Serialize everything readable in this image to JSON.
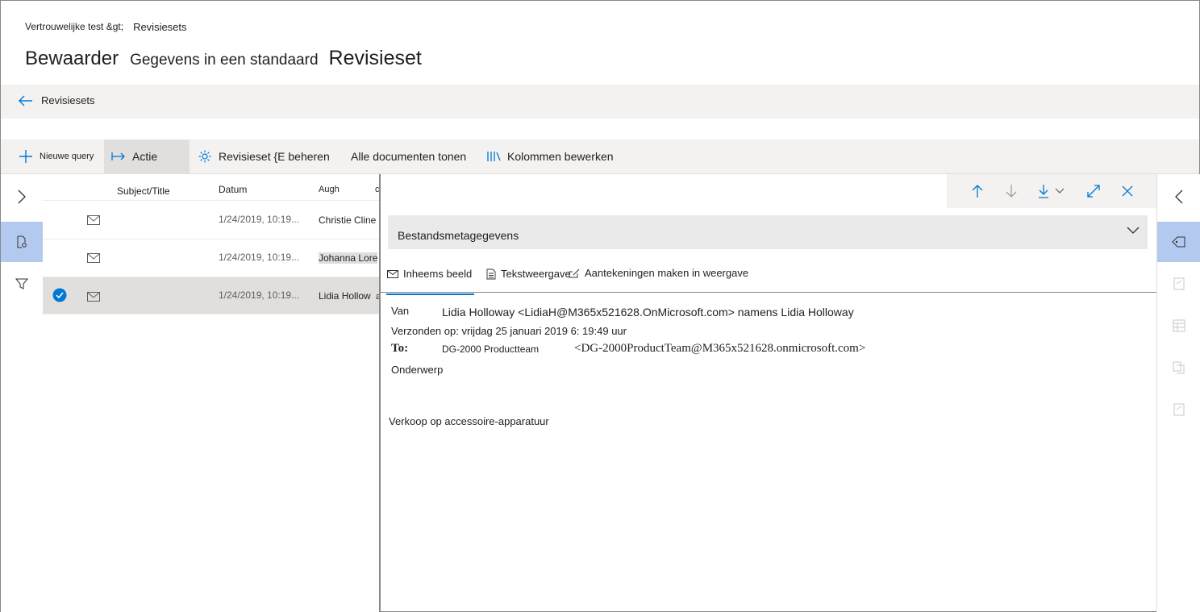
{
  "breadcrumb": {
    "parent": "Vertrouwelijke test &gt;",
    "current": "Revisiesets"
  },
  "title": {
    "part1": "Bewaarder",
    "part2": "Gegevens in een standaard",
    "part3": "Revisieset"
  },
  "back_label": "Revisiesets",
  "toolbar": {
    "new_query": "Nieuwe query",
    "action": "Actie",
    "manage": "Revisieset {E beheren",
    "show_all": "Alle documenten tonen",
    "edit_columns": "Kolommen bewerken"
  },
  "columns": {
    "subject": "Subject/Title",
    "date": "Datum",
    "author": "Augh",
    "extra": "c"
  },
  "rows": [
    {
      "date": "1/24/2019, 10:19...",
      "author": "Christie Cline",
      "selected": false
    },
    {
      "date": "1/24/2019, 10:19...",
      "author": "Johanna Lore",
      "selected": false
    },
    {
      "date": "1/24/2019, 10:19...",
      "author": "Lidia Hollow",
      "author_suffix": "a",
      "selected": true
    }
  ],
  "metadata_label": "Bestandsmetagegevens",
  "tabs": {
    "native": "Inheems beeld",
    "text": "Tekstweergave",
    "annotate": "Aantekeningen maken in weergave"
  },
  "email": {
    "from_label": "Van",
    "from_value": "Lidia Holloway <LidiaH@M365x521628.OnMicrosoft.com> namens Lidia Holloway",
    "sent": "Verzonden op: vrijdag 25 januari 2019 6: 19:49 uur",
    "to_label": "To:",
    "to_name": "DG-2000 Productteam",
    "to_address": "<DG-2000ProductTeam@M365x521628.onmicrosoft.com>",
    "subject_label": "Onderwerp",
    "body": "Verkoop op accessoire-apparatuur"
  },
  "colors": {
    "accent": "#0078d4",
    "selected_rail": "#b4c9f0",
    "bar_bg": "#f3f2f1"
  }
}
